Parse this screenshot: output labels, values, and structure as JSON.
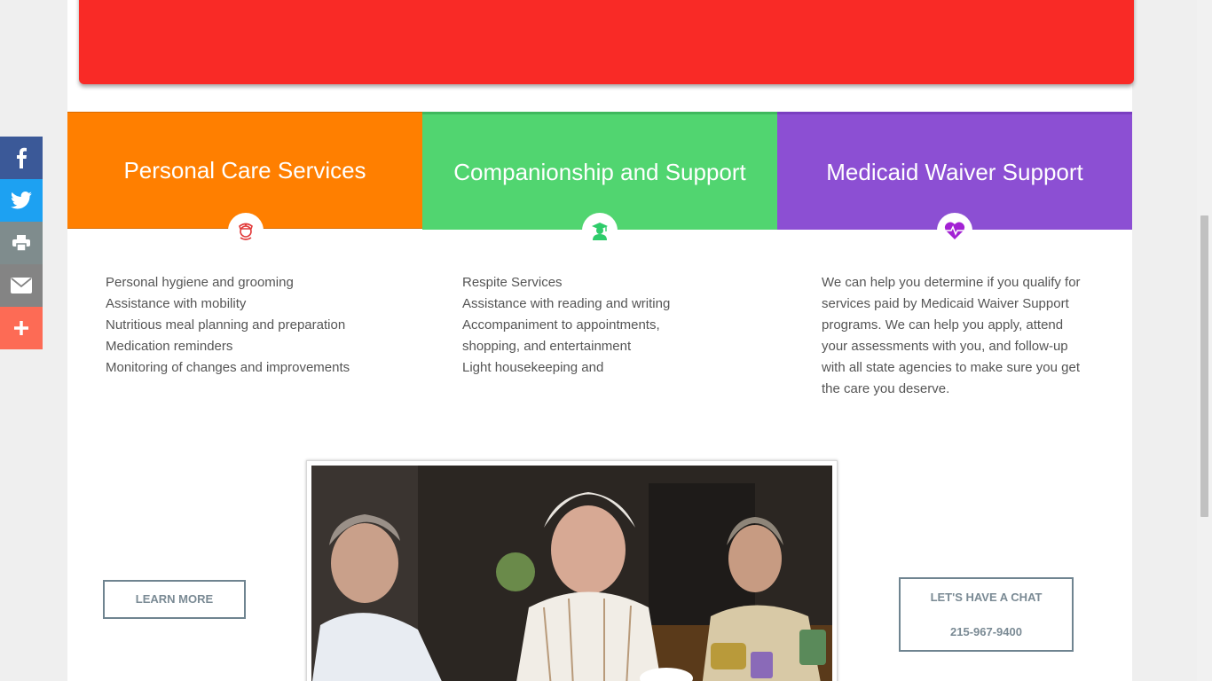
{
  "colors": {
    "banner": "#f92a26",
    "personal": "#ff7f00",
    "companion": "#51d570",
    "medicaid": "#8c4fd3",
    "facebook": "#3b5998",
    "twitter": "#1da1f2",
    "print": "#7f8c8d",
    "email": "#848484",
    "more": "#fd6b55"
  },
  "services": {
    "personal": {
      "title": "Personal Care Services",
      "icon": "nurse-icon",
      "items": [
        "Personal hygiene and grooming",
        "Assistance with mobility",
        "Nutritious meal planning and preparation",
        "Medication reminders",
        "Monitoring of changes and improvements"
      ]
    },
    "companion": {
      "title": "Companionship and Support",
      "icon": "graduate-icon",
      "items": [
        "Respite Services",
        "Assistance with reading and writing",
        "Accompaniment to appointments, shopping, and entertainment",
        "Light housekeeping and"
      ]
    },
    "medicaid": {
      "title": "Medicaid Waiver Support",
      "icon": "heartbeat-icon",
      "text": "We can help you determine if you qualify for services paid by Medicaid Waiver Support programs. We can help you apply, attend your assessments with you, and follow-up with all state agencies to make sure you get the care you deserve."
    }
  },
  "buttons": {
    "learn_more": "LEARN MORE",
    "chat_label": "LET'S HAVE A CHAT",
    "chat_phone": "215-967-9400"
  },
  "share": {
    "items": [
      "facebook-icon",
      "twitter-icon",
      "print-icon",
      "email-icon",
      "plus-icon"
    ]
  }
}
